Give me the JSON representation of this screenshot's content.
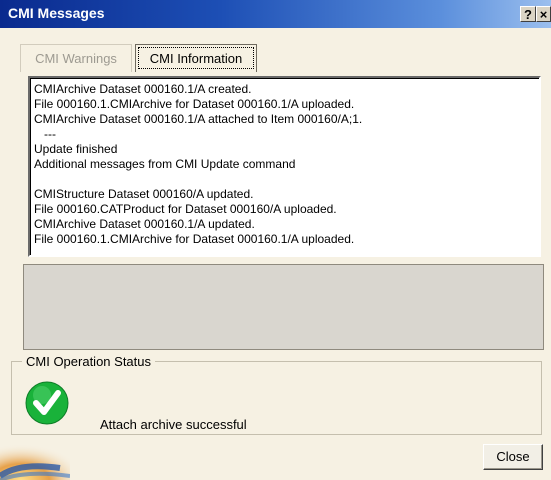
{
  "window": {
    "title": "CMI Messages",
    "help_button": "?",
    "close_button": "×"
  },
  "tabs": [
    {
      "label": "CMI Warnings",
      "active": false
    },
    {
      "label": "CMI Information",
      "active": true
    }
  ],
  "messages": [
    "CMIArchive Dataset 000160.1/A created.",
    "File 000160.1.CMIArchive for Dataset 000160.1/A uploaded.",
    "CMIArchive Dataset 000160.1/A attached to Item 000160/A;1.",
    "   ---",
    "Update finished",
    "Additional messages from CMI Update command",
    "",
    "CMIStructure Dataset 000160/A updated.",
    "File 000160.CATProduct for Dataset 000160/A uploaded.",
    "CMIArchive Dataset 000160.1/A updated.",
    "File 000160.1.CMIArchive for Dataset 000160.1/A uploaded."
  ],
  "status": {
    "group_label": "CMI Operation Status",
    "icon": "check-icon",
    "text": "Attach archive successful",
    "color": "#19b23a"
  },
  "buttons": {
    "close_label": "Close"
  }
}
